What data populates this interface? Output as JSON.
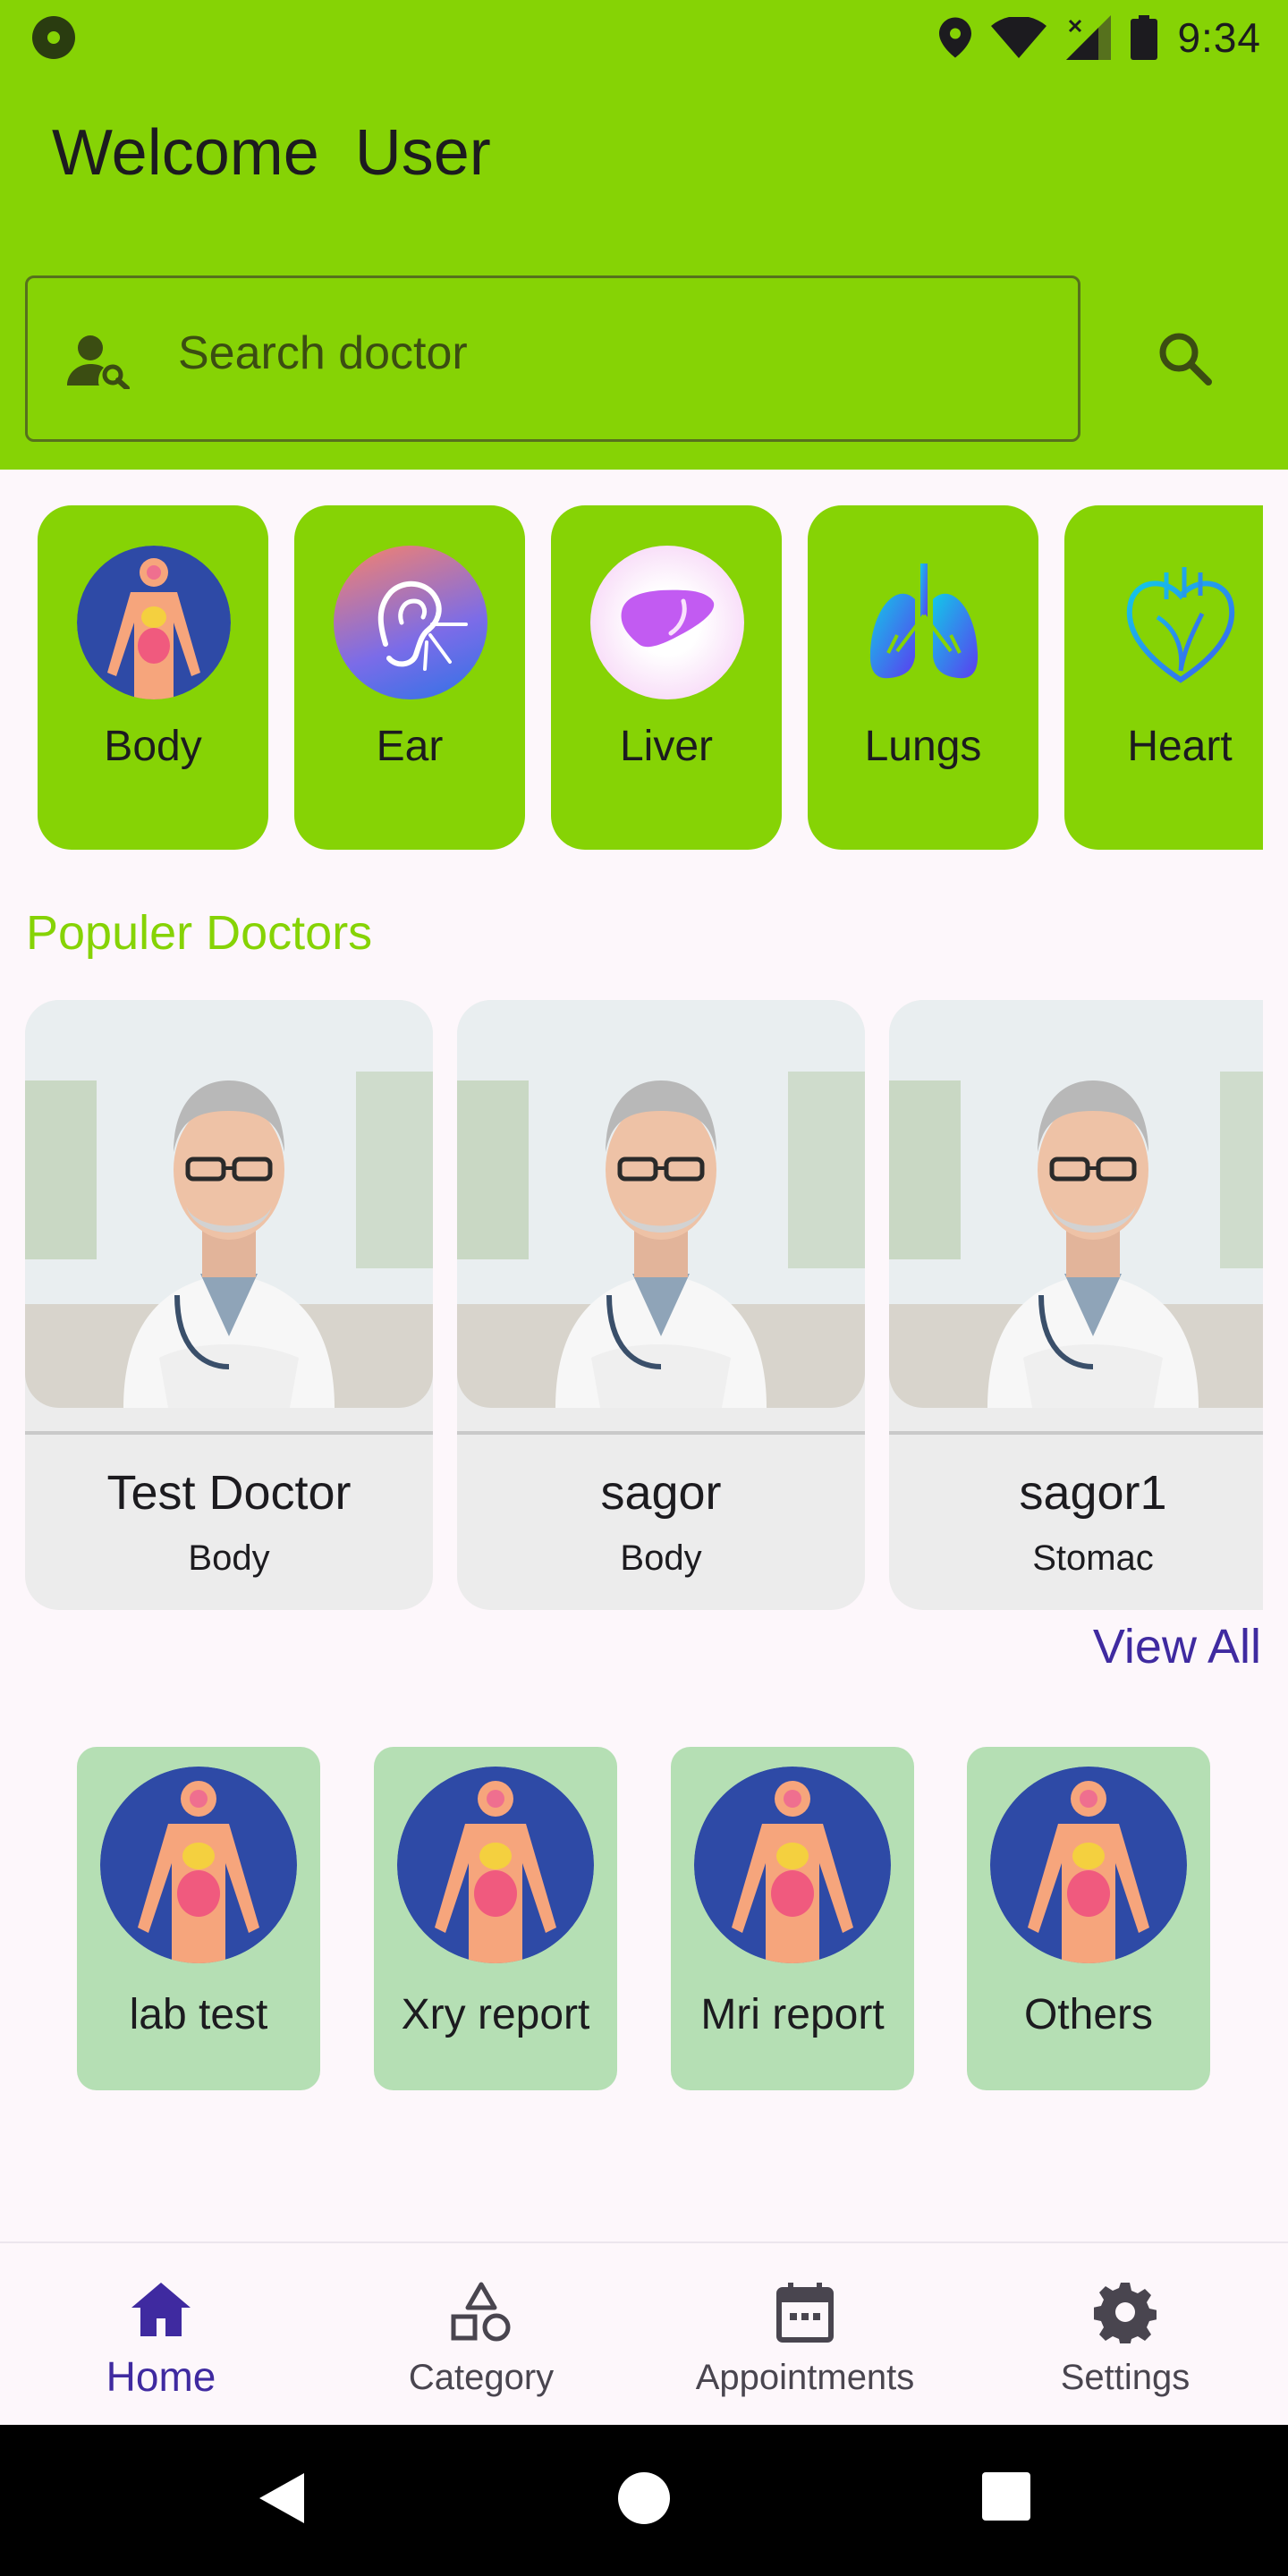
{
  "status_bar": {
    "time": "9:34"
  },
  "header": {
    "welcome": "Welcome  User"
  },
  "search": {
    "placeholder": "Search doctor"
  },
  "categories": [
    {
      "label": "Body",
      "icon": "body-organs-icon"
    },
    {
      "label": "Ear",
      "icon": "ear-icon"
    },
    {
      "label": "Liver",
      "icon": "liver-icon"
    },
    {
      "label": "Lungs",
      "icon": "lungs-icon"
    },
    {
      "label": "Heart",
      "icon": "heart-icon"
    }
  ],
  "popular": {
    "title": "Populer Doctors",
    "doctors": [
      {
        "name": "Test Doctor",
        "specialty": "Body"
      },
      {
        "name": "sagor",
        "specialty": "Body"
      },
      {
        "name": "sagor1",
        "specialty": "Stomac"
      }
    ],
    "view_all": "View All"
  },
  "reports": [
    {
      "label": "lab test"
    },
    {
      "label": "Xry report"
    },
    {
      "label": "Mri report"
    },
    {
      "label": "Others"
    }
  ],
  "bottom_nav": [
    {
      "label": "Home",
      "icon": "home-icon",
      "active": true
    },
    {
      "label": "Category",
      "icon": "shapes-icon",
      "active": false
    },
    {
      "label": "Appointments",
      "icon": "calendar-icon",
      "active": false
    },
    {
      "label": "Settings",
      "icon": "gear-icon",
      "active": false
    }
  ],
  "colors": {
    "primary_green": "#86d305",
    "report_card": "#b5dfb4",
    "accent_purple": "#3f2aa0",
    "background": "#fdf7fb"
  }
}
